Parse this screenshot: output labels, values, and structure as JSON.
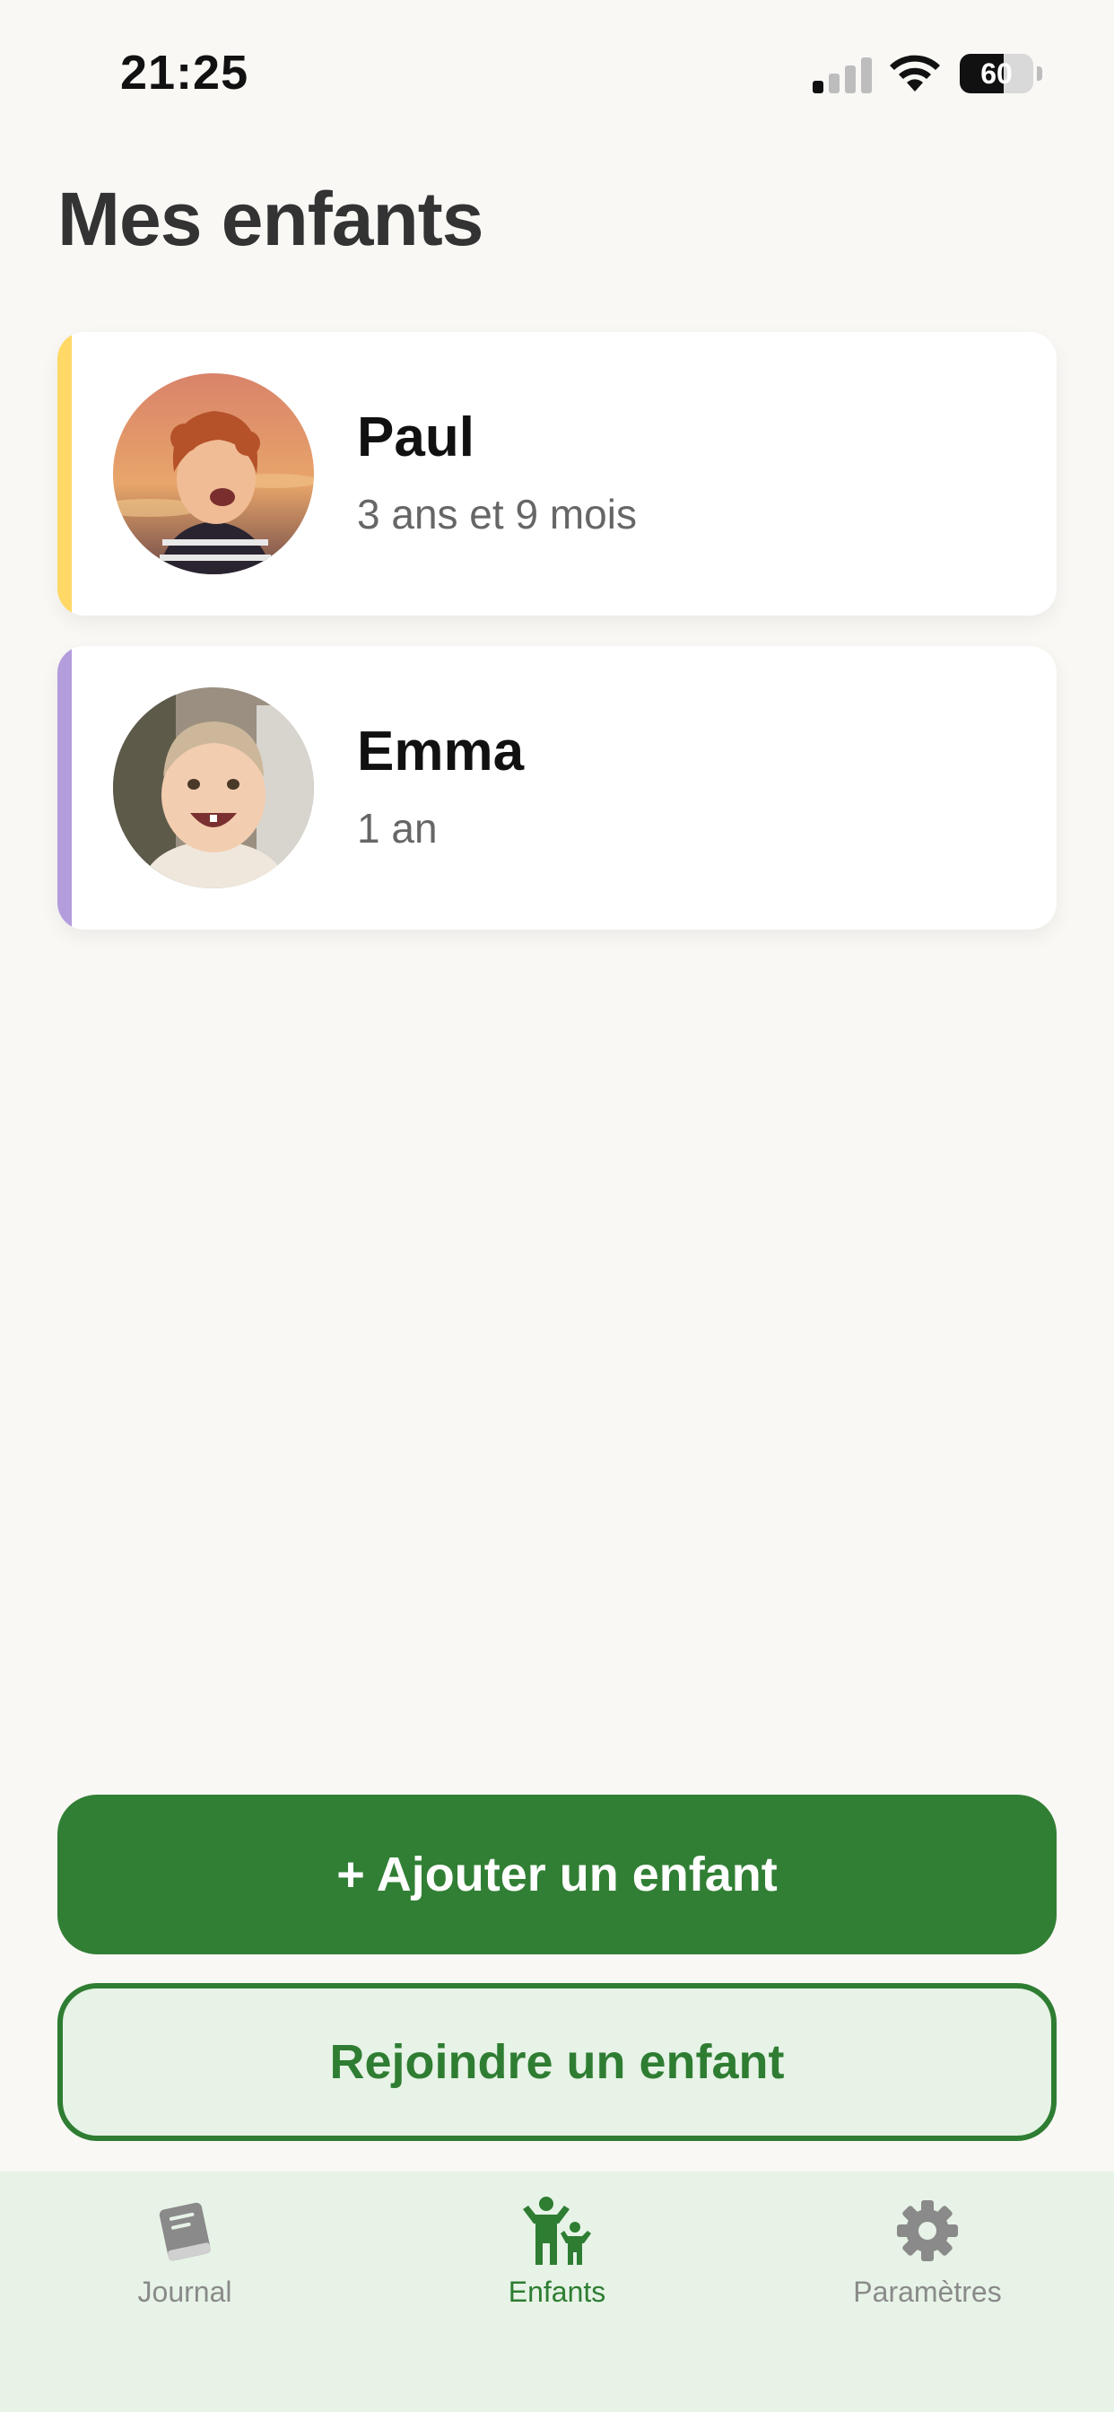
{
  "status_bar": {
    "time": "21:25",
    "battery": "60",
    "battery_level": 0.6
  },
  "page": {
    "title": "Mes enfants"
  },
  "children": [
    {
      "name": "Paul",
      "age": "3 ans et 9 mois",
      "accent_color": "#ffd866"
    },
    {
      "name": "Emma",
      "age": "1 an",
      "accent_color": "#b39ddb"
    }
  ],
  "actions": {
    "add_label": "+ Ajouter un enfant",
    "join_label": "Rejoindre un enfant"
  },
  "tab_bar": {
    "items": [
      {
        "label": "Journal",
        "icon": "book-icon",
        "active": false
      },
      {
        "label": "Enfants",
        "icon": "children-icon",
        "active": true
      },
      {
        "label": "Paramètres",
        "icon": "gear-icon",
        "active": false
      }
    ],
    "active_color": "#2e7d32",
    "inactive_color": "#8a8a8a"
  }
}
